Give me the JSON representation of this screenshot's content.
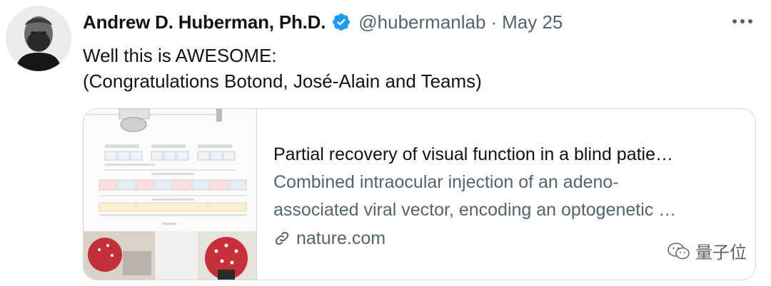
{
  "author": {
    "display_name": "Andrew D. Huberman, Ph.D.",
    "handle": "@hubermanlab",
    "separator": "·",
    "date": "May 25",
    "verified": true,
    "avatar_icon": "portrait-photo"
  },
  "tweet": {
    "lines": [
      "Well this is AWESOME:",
      "(Congratulations Botond, José-Alain and Teams)"
    ]
  },
  "card": {
    "title": "Partial recovery of visual function in a blind patie…",
    "description_lines": [
      "Combined intraocular injection of an adeno-",
      "associated viral vector, encoding an optogenetic …"
    ],
    "domain": "nature.com",
    "media_description_icon": "figure-diagram-with-photos"
  },
  "icons": {
    "more": "more-horizontal-icon",
    "verified": "verified-badge-icon",
    "link": "link-icon"
  },
  "colors": {
    "verified_blue": "#1d9bf0",
    "secondary_text": "#536471",
    "primary_text": "#0f1419",
    "border": "#cfd9de"
  },
  "watermark": {
    "text": "量子位"
  }
}
